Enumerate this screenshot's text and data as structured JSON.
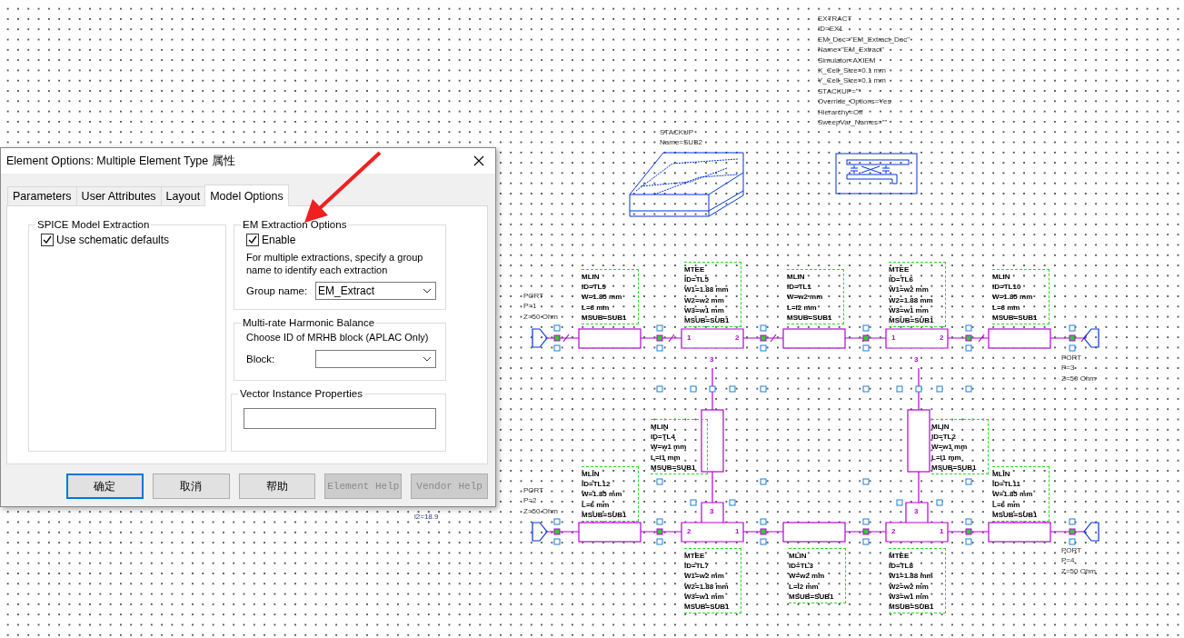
{
  "schematic": {
    "extract_block": {
      "lines": [
        "EXTRACT",
        "ID=EX1",
        "EM_Doc=\"EM_Extract_Doc\"",
        "Name=\"EM_Extract\"",
        "Simulator=AXIEM",
        "X_Cell_Size=0.1 mm",
        "Y_Cell_Size=0.1 mm",
        "STACKUP=\"\"",
        "Override_Options=Yes",
        "Hierarchy=Off",
        "SweepVar_Names=\"\""
      ]
    },
    "stackup_block": {
      "lines": [
        "STACKUP",
        "Name=SUB2"
      ]
    },
    "element_labels": [
      {
        "lines": [
          "MLIN",
          "ID=TL9",
          "W=1.85 mm",
          "L=6 mm",
          "MSUB=SUB1"
        ]
      },
      {
        "lines": [
          "MTEE",
          "ID=TL5",
          "W1=1.88 mm",
          "W2=w2 mm",
          "W3=w1 mm",
          "MSUB=SUB1"
        ]
      },
      {
        "lines": [
          "MLIN",
          "ID=TL1",
          "W=w2 mm",
          "L=l2 mm",
          "MSUB=SUB1"
        ]
      },
      {
        "lines": [
          "MTEE",
          "ID=TL6",
          "W1=w2 mm",
          "W2=1.88 mm",
          "W3=w1 mm",
          "MSUB=SUB1"
        ]
      },
      {
        "lines": [
          "MLIN",
          "ID=TL10",
          "W=1.85 mm",
          "L=6 mm",
          "MSUB=SUB1"
        ]
      },
      {
        "lines": [
          "MLIN",
          "ID=TL4",
          "W=w1 mm",
          "L=l1 mm",
          "MSUB=SUB1"
        ]
      },
      {
        "lines": [
          "MLIN",
          "ID=TL2",
          "W=w1 mm",
          "L=l1 mm",
          "MSUB=SUB1"
        ]
      },
      {
        "lines": [
          "MLIN",
          "ID=TL12",
          "W=1.85 mm",
          "L=6 mm",
          "MSUB=SUB1"
        ]
      },
      {
        "lines": [
          "MLIN",
          "ID=TL11",
          "W=1.85 mm",
          "L=6 mm",
          "MSUB=SUB1"
        ]
      },
      {
        "lines": [
          "MTEE",
          "ID=TL7",
          "W1=w2 mm",
          "W2=1.88 mm",
          "W3=w1 mm",
          "MSUB=SUB1"
        ]
      },
      {
        "lines": [
          "MLIN",
          "ID=TL3",
          "W=w2 mm",
          "L=l2 mm",
          "MSUB=SUB1"
        ]
      },
      {
        "lines": [
          "MTEE",
          "ID=TL8",
          "W1=1.88 mm",
          "W2=w2 mm",
          "W3=w1 mm",
          "MSUB=SUB1"
        ]
      }
    ],
    "port_labels": [
      {
        "lines": [
          "PORT",
          "P=1",
          "Z=50 Ohm"
        ]
      },
      {
        "lines": [
          "PORT",
          "P=3",
          "Z=50 Ohm"
        ]
      },
      {
        "lines": [
          "PORT",
          "P=2",
          "Z=50 Ohm"
        ]
      },
      {
        "lines": [
          "PORT",
          "P=4",
          "Z=50 Ohm"
        ]
      }
    ],
    "tees": [
      {
        "pins": [
          "1",
          "2",
          "3"
        ]
      },
      {
        "pins": [
          "1",
          "2",
          "3"
        ]
      },
      {
        "pins": [
          "2",
          "1",
          "3"
        ]
      },
      {
        "pins": [
          "2",
          "1",
          "3"
        ]
      }
    ],
    "partial_text": "l2=18.9"
  },
  "dialog": {
    "title": "Element Options: Multiple Element Type 属性",
    "tabs": [
      {
        "label": "Parameters",
        "selected": false
      },
      {
        "label": "User Attributes",
        "selected": false
      },
      {
        "label": "Layout",
        "selected": false
      },
      {
        "label": "Model Options",
        "selected": true
      }
    ],
    "spice_group": {
      "title": "SPICE Model Extraction",
      "checkbox": {
        "label": "Use schematic defaults",
        "checked": true
      }
    },
    "em_group": {
      "title": "EM Extraction Options",
      "checkbox": {
        "label": "Enable",
        "checked": true
      },
      "description": "For multiple extractions, specify a group name to identify each extraction",
      "group_name": {
        "label": "Group name:",
        "value": "EM_Extract"
      }
    },
    "mrhb_group": {
      "title": "Multi-rate Harmonic Balance",
      "description": "Choose ID of MRHB block (APLAC Only)",
      "block": {
        "label": "Block:"
      }
    },
    "vector_group": {
      "title": "Vector Instance Properties"
    },
    "buttons": [
      {
        "label": "确定",
        "default": true,
        "disabled": false
      },
      {
        "label": "取消",
        "default": false,
        "disabled": false
      },
      {
        "label": "帮助",
        "default": false,
        "disabled": false
      },
      {
        "label": "Element Help",
        "default": false,
        "disabled": true
      },
      {
        "label": "Vendor Help",
        "default": false,
        "disabled": true
      }
    ]
  }
}
